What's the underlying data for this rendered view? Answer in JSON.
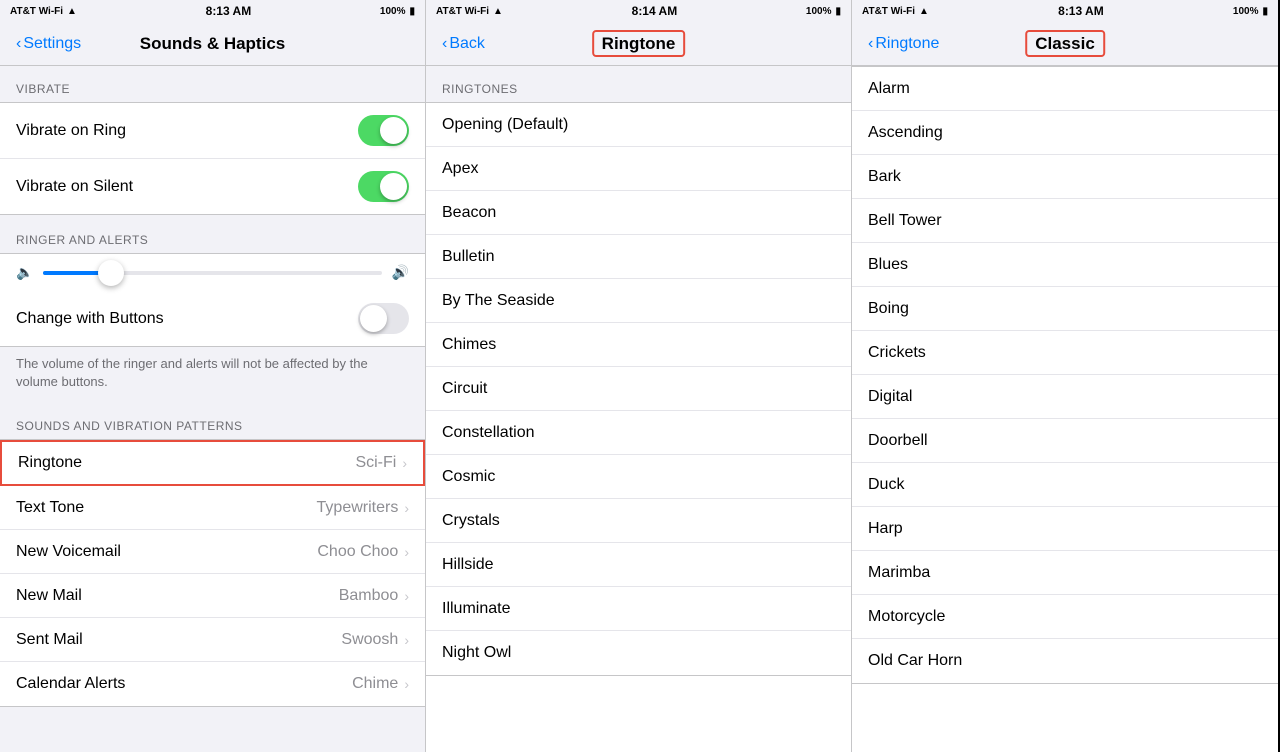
{
  "panel1": {
    "statusBar": {
      "carrier": "AT&T Wi-Fi",
      "wifiIcon": "wifi",
      "time": "8:13 AM",
      "battery": "100%"
    },
    "navTitle": "Sounds & Haptics",
    "backLabel": "Settings",
    "sections": {
      "vibrate": {
        "header": "VIBRATE",
        "items": [
          {
            "label": "Vibrate on Ring",
            "toggleOn": true
          },
          {
            "label": "Vibrate on Silent",
            "toggleOn": true
          }
        ]
      },
      "ringerAlerts": {
        "header": "RINGER AND ALERTS",
        "changeWithButtons": {
          "label": "Change with Buttons",
          "toggleOn": false
        },
        "note": "The volume of the ringer and alerts will not be affected by the volume buttons."
      },
      "soundsPatterns": {
        "header": "SOUNDS AND VIBRATION PATTERNS",
        "items": [
          {
            "label": "Ringtone",
            "value": "Sci-Fi",
            "highlighted": true
          },
          {
            "label": "Text Tone",
            "value": "Typewriters"
          },
          {
            "label": "New Voicemail",
            "value": "Choo Choo"
          },
          {
            "label": "New Mail",
            "value": "Bamboo"
          },
          {
            "label": "Sent Mail",
            "value": "Swoosh"
          },
          {
            "label": "Calendar Alerts",
            "value": "Chime"
          }
        ]
      }
    }
  },
  "panel2": {
    "statusBar": {
      "carrier": "AT&T Wi-Fi",
      "time": "8:14 AM",
      "battery": "100%"
    },
    "navBackLabel": "Back",
    "navTitle": "Ringtone",
    "sectionHeader": "RINGTONES",
    "items": [
      "Opening (Default)",
      "Apex",
      "Beacon",
      "Bulletin",
      "By The Seaside",
      "Chimes",
      "Circuit",
      "Constellation",
      "Cosmic",
      "Crystals",
      "Hillside",
      "Illuminate",
      "Night Owl"
    ]
  },
  "panel3": {
    "statusBar": {
      "carrier": "AT&T Wi-Fi",
      "time": "8:13 AM",
      "battery": "100%"
    },
    "navBackLabel": "Ringtone",
    "navTitle": "Classic",
    "items": [
      "Alarm",
      "Ascending",
      "Bark",
      "Bell Tower",
      "Blues",
      "Boing",
      "Crickets",
      "Digital",
      "Doorbell",
      "Duck",
      "Harp",
      "Marimba",
      "Motorcycle",
      "Old Car Horn"
    ]
  },
  "icons": {
    "chevron": "›",
    "back": "‹",
    "wifi": "▲",
    "battery": "▮"
  }
}
